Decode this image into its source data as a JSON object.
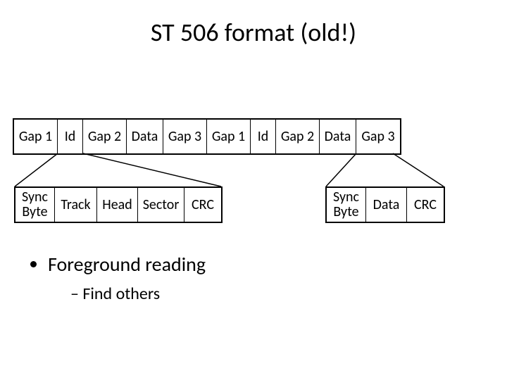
{
  "title": "ST 506 format (old!)",
  "row1": {
    "cells": [
      "Gap 1",
      "Id",
      "Gap 2",
      "Data",
      "Gap 3",
      "Gap 1",
      "Id",
      "Gap 2",
      "Data",
      "Gap 3"
    ]
  },
  "row2a": {
    "cells": [
      "Sync\nByte",
      "Track",
      "Head",
      "Sector",
      "CRC"
    ]
  },
  "row2b": {
    "cells": [
      "Sync\nByte",
      "Data",
      "CRC"
    ]
  },
  "bullets": {
    "level1": "Foreground reading",
    "level2": "Find others"
  }
}
